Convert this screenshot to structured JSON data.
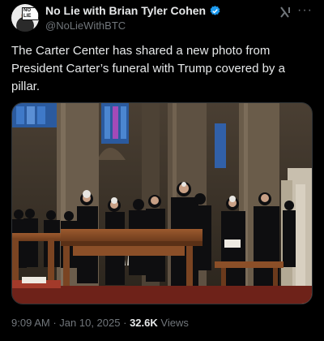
{
  "author": {
    "name": "No Lie with Brian Tyler Cohen",
    "handle": "@NoLieWithBTC",
    "avatar_logo_text": "NO LIE"
  },
  "tweet": {
    "text": "The Carter Center has shared a new photo from President Carter’s funeral with Trump covered by a pillar."
  },
  "meta": {
    "time": "9:09 AM",
    "separator": "·",
    "date": "Jan 10, 2025",
    "views_count": "32.6K",
    "views_label": "Views"
  },
  "icons": {
    "verified": "verified-badge-icon",
    "grok": "grok-icon",
    "more": "more-options-icon"
  },
  "colors": {
    "background": "#000000",
    "text": "#e7e9ea",
    "secondary": "#71767b",
    "verified": "#1d9bf0"
  }
}
